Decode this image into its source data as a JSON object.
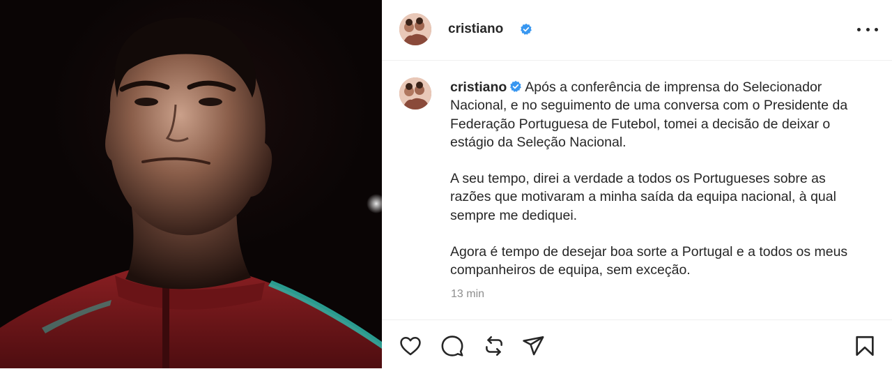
{
  "post": {
    "author": {
      "username": "cristiano",
      "verified_icon": "verified-badge-icon",
      "verified_color": "#3897f0"
    },
    "header": {
      "more_icon": "more-options-icon"
    },
    "caption": {
      "username": "cristiano",
      "paragraphs": [
        "Após a conferência de imprensa do Selecionador Nacional, e no seguimento de uma conversa com o Presidente da Federação Portuguesa de Futebol, tomei a decisão de deixar o estágio da Seleção Nacional.",
        "A seu tempo, direi a verdade a todos os Portugueses sobre as razões que motivaram a minha saída da equipa nacional, à qual sempre me dediquei.",
        "Agora é tempo de desejar boa sorte a Portugal e a todos os meus companheiros de equipa, sem exceção."
      ]
    },
    "timestamp": "13 min",
    "actions": [
      {
        "name": "like",
        "icon": "heart-icon"
      },
      {
        "name": "comment",
        "icon": "comment-icon"
      },
      {
        "name": "repost",
        "icon": "repost-icon"
      },
      {
        "name": "share",
        "icon": "send-icon"
      },
      {
        "name": "save",
        "icon": "bookmark-icon"
      }
    ],
    "colors": {
      "text": "#262626",
      "muted": "#8e8e8e",
      "jersey": "#7a1a1e",
      "jersey_stripe": "#2fb6a8"
    }
  }
}
